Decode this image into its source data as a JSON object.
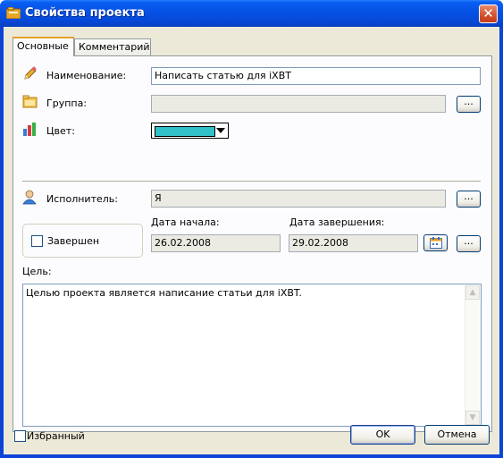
{
  "window": {
    "title": "Свойства проекта",
    "close_label": "✕"
  },
  "tabs": [
    {
      "label": "Основные"
    },
    {
      "label": "Комментарий"
    }
  ],
  "fields": {
    "name": {
      "label": "Наименование:",
      "value": "Написать статью для iXBT"
    },
    "group": {
      "label": "Группа:",
      "value": ""
    },
    "color": {
      "label": "Цвет:",
      "value_hex": "#30c0c8"
    },
    "executor": {
      "label": "Исполнитель:",
      "value": "Я"
    },
    "completed": {
      "label": "Завершен",
      "checked": false
    },
    "start_date": {
      "label": "Дата начала:",
      "value": "26.02.2008"
    },
    "end_date": {
      "label": "Дата завершения:",
      "value": "29.02.2008"
    },
    "goal": {
      "label": "Цель:",
      "value": "Целью проекта является написание статьи для iXBT."
    }
  },
  "browse_label": "...",
  "favorite": {
    "label": "Избранный",
    "checked": false
  },
  "buttons": {
    "ok": "OK",
    "cancel": "Отмена"
  },
  "colors": {
    "titlebar": "#0651e6",
    "face": "#ece9d8",
    "panel": "#fcfcfe",
    "tab_accent": "#e6a22b",
    "close": "#d3502c"
  }
}
